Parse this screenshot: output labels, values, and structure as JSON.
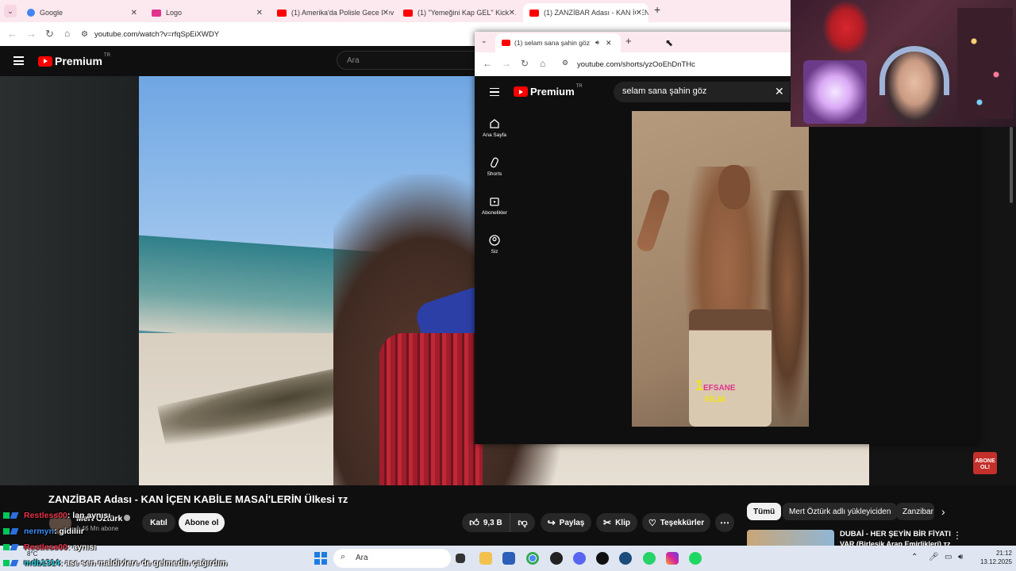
{
  "browser": {
    "tabs": [
      {
        "label": "Google",
        "color": "#4285f4"
      },
      {
        "label": "Logo",
        "color": "#e0338e"
      },
      {
        "label": "(1) Amerika'da Polisle Gece Dev",
        "color": "#ff0000"
      },
      {
        "label": "(1) \"Yemeğini Kap GEL\" Kick &",
        "color": "#ff0000"
      },
      {
        "label": "(1) ZANZİBAR Adası - KAN İÇEN",
        "color": "#ff0000"
      }
    ],
    "new_tab": "+",
    "url": "youtube.com/watch?v=rfqSpEiXWDY"
  },
  "yt": {
    "logo": "Premium",
    "region": "TR",
    "search_placeholder": "Ara",
    "abone_badge": "ABONE OL!"
  },
  "video": {
    "title": "ZANZİBAR Adası - KAN İÇEN KABİLE MASAİ'LERİN Ülkesi ᴛᴢ",
    "channel": "Mert Öztürk",
    "subscribers": "1,46 Mn abone",
    "join": "Katıl",
    "subscribe": "Abone ol",
    "likes": "9,3 B",
    "share": "Paylaş",
    "clip": "Klip",
    "thanks": "Teşekkürler"
  },
  "chips": [
    "Tümü",
    "Mert Öztürk adlı yükleyiciden",
    "Zanzibar"
  ],
  "recommendation": {
    "title": "DUBAİ - HER ŞEYİN BİR FİYATI",
    "subtitle": "VAR (Birleşik Arap Emirlikleri) ᴛᴢ"
  },
  "chat": [
    {
      "user": "Restless00",
      "msg": ": lan aynısı",
      "color": "#e8324a"
    },
    {
      "user": "nermyn",
      "msg": ": gidiliir",
      "color": "#3a8ff5"
    },
    {
      "user": "Restless00",
      "msg": ": aynısı",
      "color": "#e8324a"
    },
    {
      "user": "mdb1314",
      "msg": ": ase sen maldivlere de gelmedin çağırdım",
      "color": "#2bd1e0"
    }
  ],
  "popup": {
    "tab_title": "(1) selam sana şahin göz - Y",
    "url": "youtube.com/shorts/yzOoEhDnTHc",
    "search_value": "selam sana şahin göz",
    "nav": [
      "Ana Sayfa",
      "Shorts",
      "Abonelikler",
      "Siz"
    ],
    "watermark_top": "EFSANE",
    "watermark_num": "1",
    "watermark_bottom": "FİLM"
  },
  "taskbar": {
    "search": "Ara",
    "temp": "8°C",
    "time": "21:12",
    "date": "13.12.2025"
  }
}
